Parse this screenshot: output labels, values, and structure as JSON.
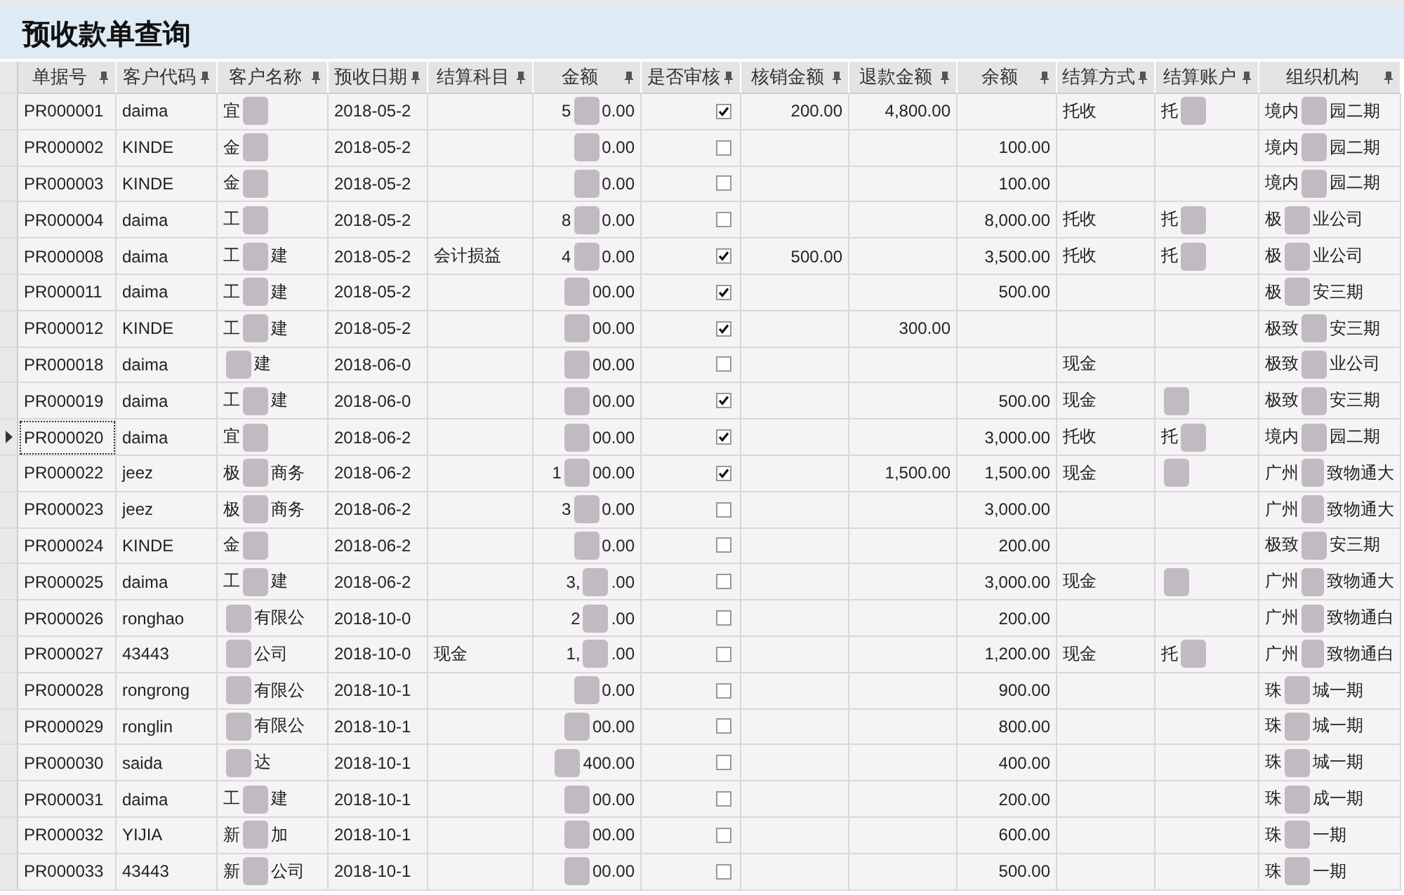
{
  "title": "预收款单查询",
  "columns": [
    "单据号",
    "客户代码",
    "客户名称",
    "预收日期",
    "结算科目",
    "金额",
    "是否审核",
    "核销金额",
    "退款金额",
    "余额",
    "结算方式",
    "结算账户",
    "组织机构"
  ],
  "rows": [
    {
      "current": false,
      "number": "PR000001",
      "customer_code": "daima",
      "customer_name": {
        "before": "宜"
      },
      "date": "2018-05-2",
      "amount": {
        "before": "5",
        "after": "0.00"
      },
      "audited": true,
      "writeoff": "200.00",
      "refund": "4,800.00",
      "method": "托收",
      "settle_account": {
        "before": "托"
      },
      "org": {
        "before": "境内",
        "after": "园二期"
      }
    },
    {
      "current": false,
      "number": "PR000002",
      "customer_code": "KINDE",
      "customer_name": {
        "before": "金"
      },
      "date": "2018-05-2",
      "amount": {
        "after": "0.00"
      },
      "audited": false,
      "balance": "100.00",
      "org": {
        "before": "境内",
        "after": "园二期"
      }
    },
    {
      "current": false,
      "number": "PR000003",
      "customer_code": "KINDE",
      "customer_name": {
        "before": "金"
      },
      "date": "2018-05-2",
      "amount": {
        "after": "0.00"
      },
      "audited": false,
      "balance": "100.00",
      "org": {
        "before": "境内",
        "after": "园二期"
      }
    },
    {
      "current": false,
      "number": "PR000004",
      "customer_code": "daima",
      "customer_name": {
        "before": "工"
      },
      "date": "2018-05-2",
      "amount": {
        "before": "8",
        "after": "0.00"
      },
      "audited": false,
      "balance": "8,000.00",
      "method": "托收",
      "settle_account": {
        "before": "托"
      },
      "org": {
        "before": "极",
        "after": "业公司"
      }
    },
    {
      "current": false,
      "number": "PR000008",
      "customer_code": "daima",
      "customer_name": {
        "before": "工",
        "after": "建"
      },
      "date": "2018-05-2",
      "account_subject": "会计损益",
      "amount": {
        "before": "4",
        "after": "0.00"
      },
      "audited": true,
      "writeoff": "500.00",
      "balance": "3,500.00",
      "method": "托收",
      "settle_account": {
        "before": "托"
      },
      "org": {
        "before": "极",
        "after": "业公司"
      }
    },
    {
      "current": false,
      "number": "PR000011",
      "customer_code": "daima",
      "customer_name": {
        "before": "工",
        "after": "建"
      },
      "date": "2018-05-2",
      "amount": {
        "after": "00.00"
      },
      "audited": true,
      "balance": "500.00",
      "org": {
        "before": "极",
        "after": "安三期"
      }
    },
    {
      "current": false,
      "number": "PR000012",
      "customer_code": "KINDE",
      "customer_name": {
        "before": "工",
        "after": "建"
      },
      "date": "2018-05-2",
      "amount": {
        "after": "00.00"
      },
      "audited": true,
      "refund": "300.00",
      "org": {
        "before": "极致",
        "after": "安三期"
      }
    },
    {
      "current": false,
      "number": "PR000018",
      "customer_code": "daima",
      "customer_name": {
        "after": "建"
      },
      "date": "2018-06-0",
      "amount": {
        "after": "00.00"
      },
      "audited": false,
      "method": "现金",
      "org": {
        "before": "极致",
        "after": "业公司"
      }
    },
    {
      "current": false,
      "number": "PR000019",
      "customer_code": "daima",
      "customer_name": {
        "before": "工",
        "after": "建"
      },
      "date": "2018-06-0",
      "amount": {
        "after": "00.00"
      },
      "audited": true,
      "balance": "500.00",
      "method": "现金",
      "settle_account": {},
      "org": {
        "before": "极致",
        "after": "安三期"
      }
    },
    {
      "current": true,
      "number": "PR000020",
      "customer_code": "daima",
      "customer_name": {
        "before": "宜"
      },
      "date": "2018-06-2",
      "amount": {
        "after": "00.00"
      },
      "audited": true,
      "balance": "3,000.00",
      "method": "托收",
      "settle_account": {
        "before": "托"
      },
      "org": {
        "before": "境内",
        "after": "园二期"
      }
    },
    {
      "current": false,
      "number": "PR000022",
      "customer_code": "jeez",
      "customer_name": {
        "before": "极",
        "after": "商务"
      },
      "date": "2018-06-2",
      "amount": {
        "before": "1",
        "after": "00.00"
      },
      "audited": true,
      "refund": "1,500.00",
      "balance": "1,500.00",
      "method": "现金",
      "settle_account": {},
      "org": {
        "before": "广州",
        "after": "致物通大"
      }
    },
    {
      "current": false,
      "number": "PR000023",
      "customer_code": "jeez",
      "customer_name": {
        "before": "极",
        "after": "商务"
      },
      "date": "2018-06-2",
      "amount": {
        "before": "3",
        "after": "0.00"
      },
      "audited": false,
      "balance": "3,000.00",
      "org": {
        "before": "广州",
        "after": "致物通大"
      }
    },
    {
      "current": false,
      "number": "PR000024",
      "customer_code": "KINDE",
      "customer_name": {
        "before": "金"
      },
      "date": "2018-06-2",
      "amount": {
        "after": "0.00"
      },
      "audited": false,
      "balance": "200.00",
      "org": {
        "before": "极致",
        "after": "安三期"
      }
    },
    {
      "current": false,
      "number": "PR000025",
      "customer_code": "daima",
      "customer_name": {
        "before": "工",
        "after": "建"
      },
      "date": "2018-06-2",
      "amount": {
        "before": "3,",
        "after": ".00"
      },
      "audited": false,
      "balance": "3,000.00",
      "method": "现金",
      "settle_account": {},
      "org": {
        "before": "广州",
        "after": "致物通大"
      }
    },
    {
      "current": false,
      "number": "PR000026",
      "customer_code": "ronghao",
      "customer_name": {
        "after": "有限公"
      },
      "date": "2018-10-0",
      "amount": {
        "before": "2",
        "after": ".00"
      },
      "audited": false,
      "balance": "200.00",
      "org": {
        "before": "广州",
        "after": "致物通白"
      }
    },
    {
      "current": false,
      "number": "PR000027",
      "customer_code": "43443",
      "customer_name": {
        "after": "公司"
      },
      "date": "2018-10-0",
      "account_subject": "现金",
      "amount": {
        "before": "1,",
        "after": ".00"
      },
      "audited": false,
      "balance": "1,200.00",
      "method": "现金",
      "settle_account": {
        "before": "托"
      },
      "org": {
        "before": "广州",
        "after": "致物通白"
      }
    },
    {
      "current": false,
      "number": "PR000028",
      "customer_code": "rongrong",
      "customer_name": {
        "after": "有限公"
      },
      "date": "2018-10-1",
      "amount": {
        "after": "0.00"
      },
      "audited": false,
      "balance": "900.00",
      "org": {
        "before": "珠",
        "after": "城一期"
      }
    },
    {
      "current": false,
      "number": "PR000029",
      "customer_code": "ronglin",
      "customer_name": {
        "after": "有限公"
      },
      "date": "2018-10-1",
      "amount": {
        "after": "00.00"
      },
      "audited": false,
      "balance": "800.00",
      "org": {
        "before": "珠",
        "after": "城一期"
      }
    },
    {
      "current": false,
      "number": "PR000030",
      "customer_code": "saida",
      "customer_name": {
        "after": "达"
      },
      "date": "2018-10-1",
      "amount": {
        "after": "400.00"
      },
      "audited": false,
      "balance": "400.00",
      "org": {
        "before": "珠",
        "after": "城一期"
      }
    },
    {
      "current": false,
      "number": "PR000031",
      "customer_code": "daima",
      "customer_name": {
        "before": "工",
        "after": "建"
      },
      "date": "2018-10-1",
      "amount": {
        "after": "00.00"
      },
      "audited": false,
      "balance": "200.00",
      "org": {
        "before": "珠",
        "after": "成一期"
      }
    },
    {
      "current": false,
      "number": "PR000032",
      "customer_code": "YIJIA",
      "customer_name": {
        "before": "新",
        "after": "加"
      },
      "date": "2018-10-1",
      "amount": {
        "after": "00.00"
      },
      "audited": false,
      "balance": "600.00",
      "org": {
        "before": "珠",
        "after": "一期"
      }
    },
    {
      "current": false,
      "number": "PR000033",
      "customer_code": "43443",
      "customer_name": {
        "before": "新",
        "after": "公司"
      },
      "date": "2018-10-1",
      "amount": {
        "after": "00.00"
      },
      "audited": false,
      "balance": "500.00",
      "org": {
        "before": "珠",
        "after": "一期"
      }
    }
  ]
}
